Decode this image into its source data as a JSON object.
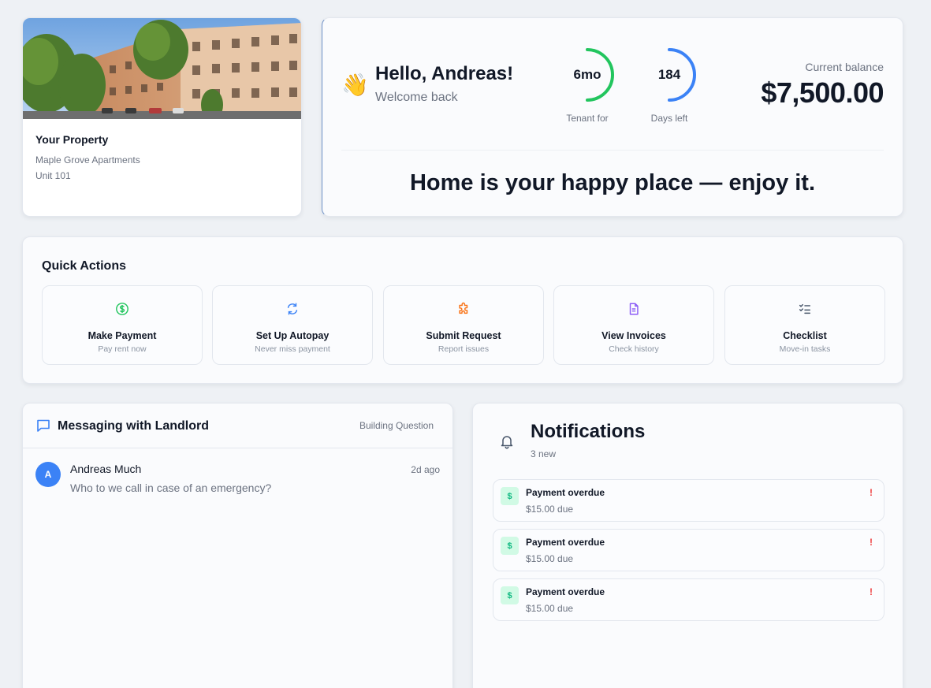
{
  "property": {
    "title": "Your Property",
    "building": "Maple Grove Apartments",
    "unit": "Unit 101"
  },
  "greeting": {
    "hello": "Hello, Andreas!",
    "welcome": "Welcome back",
    "wave_icon": "waving-hand-icon",
    "tenant_gauge": {
      "value": "6mo",
      "label": "Tenant for",
      "progress": 0.5,
      "color": "#22c55e"
    },
    "days_gauge": {
      "value": "184",
      "label": "Days left",
      "progress": 0.5,
      "color": "#3b82f6"
    },
    "balance_label": "Current balance",
    "balance_value": "$7,500.00",
    "motto": "Home is your happy place — enjoy it."
  },
  "quick_actions": {
    "title": "Quick Actions",
    "items": [
      {
        "label": "Make Payment",
        "sub": "Pay rent now",
        "icon": "dollar-circle-icon",
        "color": "#22c55e"
      },
      {
        "label": "Set Up Autopay",
        "sub": "Never miss payment",
        "icon": "refresh-icon",
        "color": "#3b82f6"
      },
      {
        "label": "Submit Request",
        "sub": "Report issues",
        "icon": "puzzle-icon",
        "color": "#f97316"
      },
      {
        "label": "View Invoices",
        "sub": "Check history",
        "icon": "document-icon",
        "color": "#8b5cf6"
      },
      {
        "label": "Checklist",
        "sub": "Move-in tasks",
        "icon": "checklist-icon",
        "color": "#475569"
      }
    ]
  },
  "messaging": {
    "title": "Messaging with Landlord",
    "tag": "Building Question",
    "messages": [
      {
        "initial": "A",
        "author": "Andreas Much",
        "time": "2d ago",
        "text": "Who to we call in case of an emergency?"
      }
    ]
  },
  "notifications": {
    "title": "Notifications",
    "count": "3 new",
    "items": [
      {
        "title": "Payment overdue",
        "sub": "$15.00 due",
        "icon": "dollar-icon",
        "icon_glyph": "$",
        "alert": "!"
      },
      {
        "title": "Payment overdue",
        "sub": "$15.00 due",
        "icon": "dollar-icon",
        "icon_glyph": "$",
        "alert": "!"
      },
      {
        "title": "Payment overdue",
        "sub": "$15.00 due",
        "icon": "dollar-icon",
        "icon_glyph": "$",
        "alert": "!"
      }
    ]
  }
}
